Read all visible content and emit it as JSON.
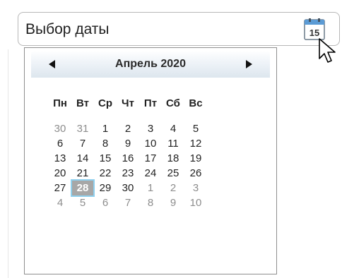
{
  "date_input": {
    "placeholder": "Выбор даты",
    "calendar_button_day": "15"
  },
  "calendar": {
    "month_title": "Апрель 2020",
    "weekday_headers": [
      "Пн",
      "Вт",
      "Ср",
      "Чт",
      "Пт",
      "Сб",
      "Вс"
    ],
    "weeks": [
      [
        "30",
        "31",
        "1",
        "2",
        "3",
        "4",
        "5"
      ],
      [
        "6",
        "7",
        "8",
        "9",
        "10",
        "11",
        "12"
      ],
      [
        "13",
        "14",
        "15",
        "16",
        "17",
        "18",
        "19"
      ],
      [
        "20",
        "21",
        "22",
        "23",
        "24",
        "25",
        "26"
      ],
      [
        "27",
        "28",
        "29",
        "30",
        "1",
        "2",
        "3"
      ],
      [
        "4",
        "5",
        "6",
        "7",
        "8",
        "9",
        "10"
      ]
    ],
    "selected_day": "28"
  },
  "colors": {
    "selected_fill": "#a7a7a7",
    "selected_outline": "#8fd0ee",
    "other_month_text": "#8d8d8d"
  }
}
